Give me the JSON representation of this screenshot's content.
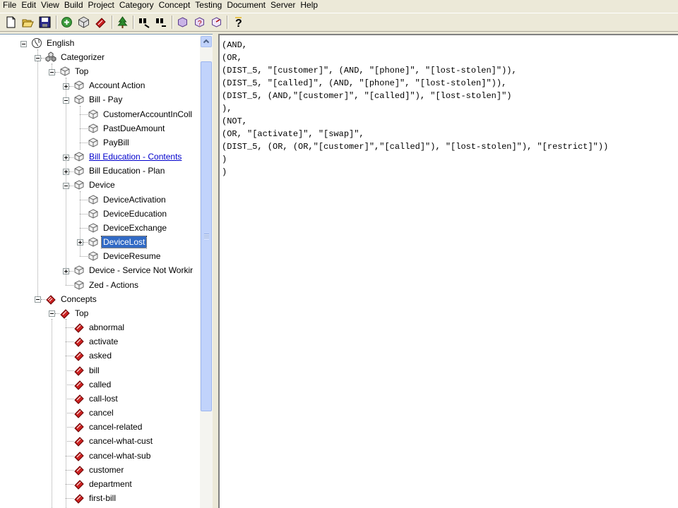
{
  "menubar": {
    "items": [
      "File",
      "Edit",
      "View",
      "Build",
      "Project",
      "Category",
      "Concept",
      "Testing",
      "Document",
      "Server",
      "Help"
    ]
  },
  "toolbar": {
    "buttons": [
      "new-icon",
      "open-icon",
      "save-icon",
      "build-icon",
      "categorizer-icon",
      "concepts-icon",
      "tree-icon",
      "find-icon",
      "find-next-icon",
      "test-icon",
      "query-icon",
      "export-icon",
      "help-icon"
    ]
  },
  "tree": {
    "root": "English",
    "categorizer": {
      "label": "Categorizer",
      "top": "Top",
      "items": [
        "Account Action",
        "Bill - Pay",
        "CustomerAccountInColl",
        "PastDueAmount",
        "PayBill",
        "Bill Education - Contents",
        "Bill Education - Plan",
        "Device",
        "DeviceActivation",
        "DeviceEducation",
        "DeviceExchange",
        "DeviceLost",
        "DeviceResume",
        "Device - Service Not Workir",
        "Zed - Actions"
      ],
      "selected": "DeviceLost"
    },
    "concepts": {
      "label": "Concepts",
      "top": "Top",
      "items": [
        "abnormal",
        "activate",
        "asked",
        "bill",
        "called",
        "call-lost",
        "cancel",
        "cancel-related",
        "cancel-what-cust",
        "cancel-what-sub",
        "customer",
        "department",
        "first-bill"
      ]
    }
  },
  "editor": {
    "lines": [
      "(AND,",
      "(OR,",
      "(DIST_5, \"[customer]\", (AND, \"[phone]\", \"[lost-stolen]\")),",
      "(DIST_5, \"[called]\", (AND, \"[phone]\", \"[lost-stolen]\")),",
      "(DIST_5, (AND,\"[customer]\", \"[called]\"), \"[lost-stolen]\")",
      "),",
      "(NOT,",
      "(OR, \"[activate]\", \"[swap]\",",
      "(DIST_5, (OR, (OR,\"[customer]\",\"[called]\"), \"[lost-stolen]\"), \"[restrict]\"))",
      ")",
      ")"
    ]
  },
  "colors": {
    "selection": "#316ac5",
    "link": "#0000cc",
    "chrome": "#ece9d8"
  }
}
